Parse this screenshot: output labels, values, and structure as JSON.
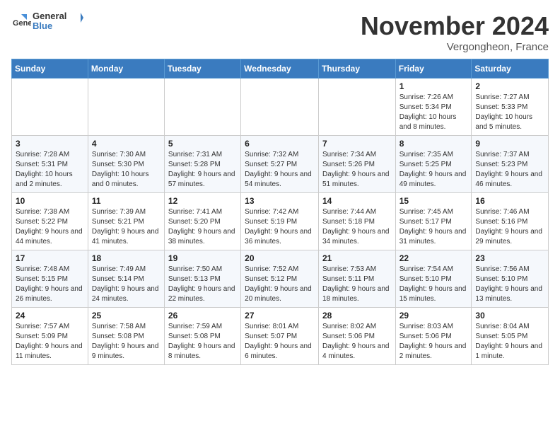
{
  "header": {
    "logo": "GeneralBlue",
    "month": "November 2024",
    "location": "Vergongheon, France"
  },
  "weekdays": [
    "Sunday",
    "Monday",
    "Tuesday",
    "Wednesday",
    "Thursday",
    "Friday",
    "Saturday"
  ],
  "weeks": [
    [
      {
        "day": "",
        "info": ""
      },
      {
        "day": "",
        "info": ""
      },
      {
        "day": "",
        "info": ""
      },
      {
        "day": "",
        "info": ""
      },
      {
        "day": "",
        "info": ""
      },
      {
        "day": "1",
        "info": "Sunrise: 7:26 AM\nSunset: 5:34 PM\nDaylight: 10 hours and 8 minutes."
      },
      {
        "day": "2",
        "info": "Sunrise: 7:27 AM\nSunset: 5:33 PM\nDaylight: 10 hours and 5 minutes."
      }
    ],
    [
      {
        "day": "3",
        "info": "Sunrise: 7:28 AM\nSunset: 5:31 PM\nDaylight: 10 hours and 2 minutes."
      },
      {
        "day": "4",
        "info": "Sunrise: 7:30 AM\nSunset: 5:30 PM\nDaylight: 10 hours and 0 minutes."
      },
      {
        "day": "5",
        "info": "Sunrise: 7:31 AM\nSunset: 5:28 PM\nDaylight: 9 hours and 57 minutes."
      },
      {
        "day": "6",
        "info": "Sunrise: 7:32 AM\nSunset: 5:27 PM\nDaylight: 9 hours and 54 minutes."
      },
      {
        "day": "7",
        "info": "Sunrise: 7:34 AM\nSunset: 5:26 PM\nDaylight: 9 hours and 51 minutes."
      },
      {
        "day": "8",
        "info": "Sunrise: 7:35 AM\nSunset: 5:25 PM\nDaylight: 9 hours and 49 minutes."
      },
      {
        "day": "9",
        "info": "Sunrise: 7:37 AM\nSunset: 5:23 PM\nDaylight: 9 hours and 46 minutes."
      }
    ],
    [
      {
        "day": "10",
        "info": "Sunrise: 7:38 AM\nSunset: 5:22 PM\nDaylight: 9 hours and 44 minutes."
      },
      {
        "day": "11",
        "info": "Sunrise: 7:39 AM\nSunset: 5:21 PM\nDaylight: 9 hours and 41 minutes."
      },
      {
        "day": "12",
        "info": "Sunrise: 7:41 AM\nSunset: 5:20 PM\nDaylight: 9 hours and 38 minutes."
      },
      {
        "day": "13",
        "info": "Sunrise: 7:42 AM\nSunset: 5:19 PM\nDaylight: 9 hours and 36 minutes."
      },
      {
        "day": "14",
        "info": "Sunrise: 7:44 AM\nSunset: 5:18 PM\nDaylight: 9 hours and 34 minutes."
      },
      {
        "day": "15",
        "info": "Sunrise: 7:45 AM\nSunset: 5:17 PM\nDaylight: 9 hours and 31 minutes."
      },
      {
        "day": "16",
        "info": "Sunrise: 7:46 AM\nSunset: 5:16 PM\nDaylight: 9 hours and 29 minutes."
      }
    ],
    [
      {
        "day": "17",
        "info": "Sunrise: 7:48 AM\nSunset: 5:15 PM\nDaylight: 9 hours and 26 minutes."
      },
      {
        "day": "18",
        "info": "Sunrise: 7:49 AM\nSunset: 5:14 PM\nDaylight: 9 hours and 24 minutes."
      },
      {
        "day": "19",
        "info": "Sunrise: 7:50 AM\nSunset: 5:13 PM\nDaylight: 9 hours and 22 minutes."
      },
      {
        "day": "20",
        "info": "Sunrise: 7:52 AM\nSunset: 5:12 PM\nDaylight: 9 hours and 20 minutes."
      },
      {
        "day": "21",
        "info": "Sunrise: 7:53 AM\nSunset: 5:11 PM\nDaylight: 9 hours and 18 minutes."
      },
      {
        "day": "22",
        "info": "Sunrise: 7:54 AM\nSunset: 5:10 PM\nDaylight: 9 hours and 15 minutes."
      },
      {
        "day": "23",
        "info": "Sunrise: 7:56 AM\nSunset: 5:10 PM\nDaylight: 9 hours and 13 minutes."
      }
    ],
    [
      {
        "day": "24",
        "info": "Sunrise: 7:57 AM\nSunset: 5:09 PM\nDaylight: 9 hours and 11 minutes."
      },
      {
        "day": "25",
        "info": "Sunrise: 7:58 AM\nSunset: 5:08 PM\nDaylight: 9 hours and 9 minutes."
      },
      {
        "day": "26",
        "info": "Sunrise: 7:59 AM\nSunset: 5:08 PM\nDaylight: 9 hours and 8 minutes."
      },
      {
        "day": "27",
        "info": "Sunrise: 8:01 AM\nSunset: 5:07 PM\nDaylight: 9 hours and 6 minutes."
      },
      {
        "day": "28",
        "info": "Sunrise: 8:02 AM\nSunset: 5:06 PM\nDaylight: 9 hours and 4 minutes."
      },
      {
        "day": "29",
        "info": "Sunrise: 8:03 AM\nSunset: 5:06 PM\nDaylight: 9 hours and 2 minutes."
      },
      {
        "day": "30",
        "info": "Sunrise: 8:04 AM\nSunset: 5:05 PM\nDaylight: 9 hours and 1 minute."
      }
    ]
  ]
}
